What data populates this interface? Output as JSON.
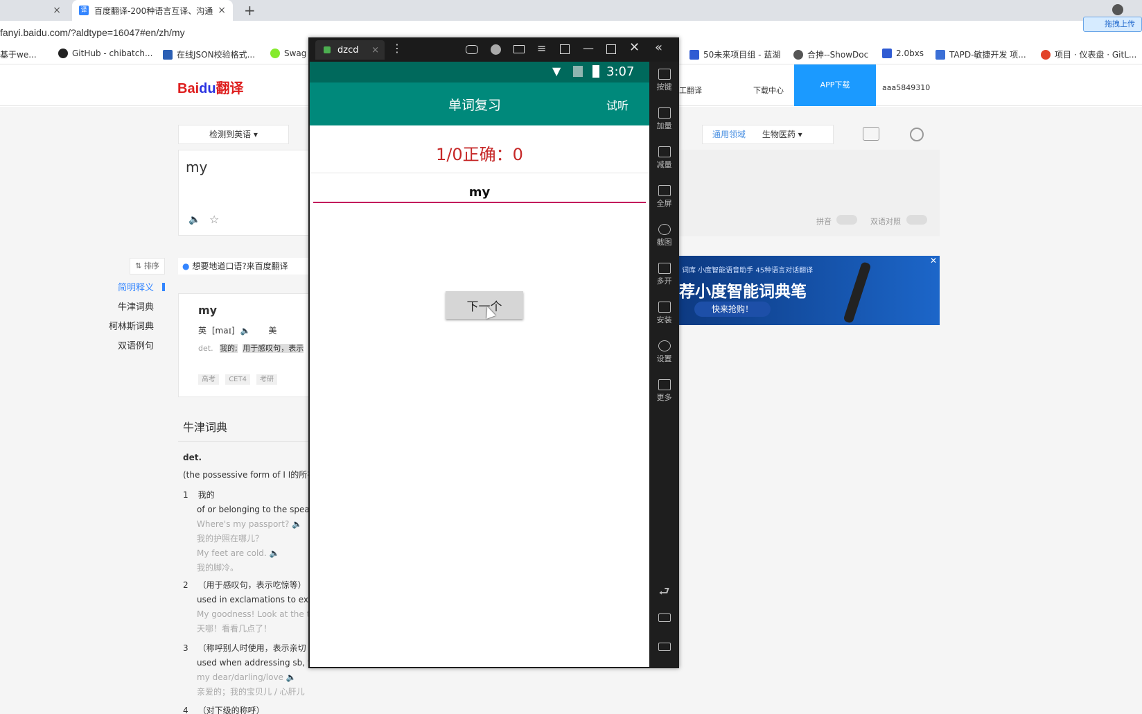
{
  "browser": {
    "tabs": [
      {
        "label": "",
        "close": "×"
      },
      {
        "label": "百度翻译-200种语言互译、沟通",
        "close": "×"
      }
    ],
    "new_tab": "+",
    "url": "fanyi.baidu.com/?aldtype=16047#en/zh/my",
    "bookmarks": [
      "基于we...",
      "GitHub - chibatch...",
      "在线JSON校验格式...",
      "Swag",
      "50未来项目组 - 蓝湖",
      "合抻--ShowDoc",
      "2.0bxs",
      "TAPD-敏捷开发 项...",
      "项目 · 仪表盘 · GitL..."
    ],
    "upload_badge": "拖拽上传"
  },
  "baidu": {
    "logo_a": "Bai",
    "logo_b": "du",
    "logo_c": "翻译",
    "nav": [
      "工翻译",
      "下载中心",
      "APP下载",
      "aaa5849310"
    ],
    "source_lang": "检测到英语",
    "input_text": "my",
    "domain_general": "通用领域",
    "domain_bio": "生物医药",
    "pinyin": "拼音",
    "bilingual": "双语对照",
    "promo_text": "想要地道口语?来百度翻译",
    "sort_label": "排序",
    "side_nav": [
      "简明释义",
      "牛津词典",
      "柯林斯词典",
      "双语例句"
    ],
    "entry_word": "my",
    "uk": "英",
    "uk_phon": "[maɪ]",
    "us": "美",
    "pos": "det.",
    "meaning_1": "我的;",
    "meaning_2": "用于感叹句，表示",
    "tags": [
      "高考",
      "CET4",
      "考研"
    ],
    "oxford_title": "牛津词典",
    "oxford_pos": "det.",
    "oxford_def": "(the possessive form of I I的所有",
    "senses": [
      {
        "num": "1",
        "zh": "我的",
        "en": "of or belonging to the speake",
        "ex1": "Where's my passport?",
        "ex1_zh": "我的护照在哪儿？",
        "ex2": "My feet are cold.",
        "ex2_zh": "我的脚冷。"
      },
      {
        "num": "2",
        "zh": "（用于感叹句，表示吃惊等）",
        "en": "used in exclamations to expr",
        "ex1": "My goodness! Look at the tir",
        "ex1_zh": "天哪！看看几点了！"
      },
      {
        "num": "3",
        "zh": "（称呼别人时使用，表示亲切",
        "en": "used when addressing sb, to",
        "ex1": "my dear/darling/love",
        "ex1_zh": "亲爱的；我的宝贝儿 / 心肝儿"
      },
      {
        "num": "4",
        "zh": "（对下级的称呼）"
      }
    ],
    "ad_line1": "词库  小度智能语音助手  45种语言对话翻译",
    "ad_title": "荐小度智能词典笔",
    "ad_cta": "快来抢购！"
  },
  "emulator": {
    "tab_label": "dzcd",
    "time": "3:07",
    "app_title": "单词复习",
    "listen": "试听",
    "score": "1/0正确：0",
    "word": "my",
    "next_button": "下一个",
    "sidebar": [
      "按键",
      "加量",
      "减量",
      "全屏",
      "截图",
      "多开",
      "安装",
      "设置",
      "更多"
    ]
  }
}
